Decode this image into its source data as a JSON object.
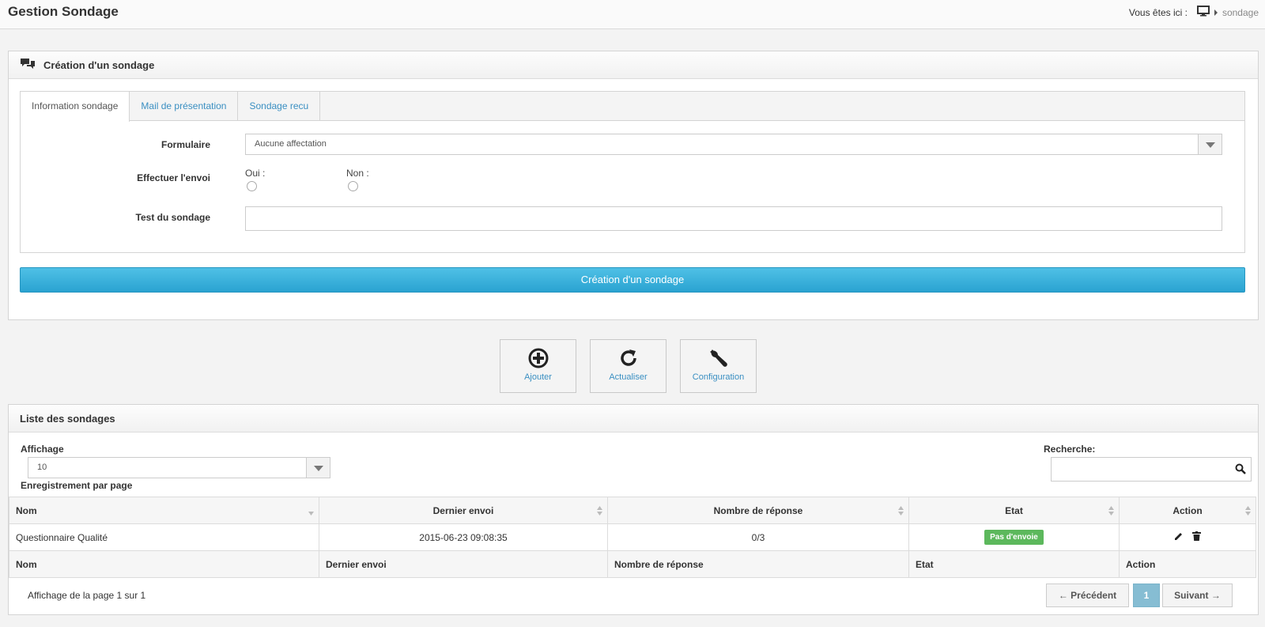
{
  "header": {
    "title": "Gestion Sondage",
    "breadcrumb_prefix": "Vous êtes ici :",
    "breadcrumb_current": "sondage"
  },
  "creation_panel": {
    "title": "Création d'un sondage",
    "tabs": [
      {
        "label": "Information sondage",
        "active": true
      },
      {
        "label": "Mail de présentation",
        "active": false
      },
      {
        "label": "Sondage recu",
        "active": false
      }
    ],
    "fields": {
      "formulaire_label": "Formulaire",
      "formulaire_value": "Aucune affectation",
      "envoi_label": "Effectuer l'envoi",
      "oui_label": "Oui :",
      "non_label": "Non :",
      "test_label": "Test du sondage",
      "test_value": ""
    },
    "submit_label": "Création d'un sondage"
  },
  "toolbar": {
    "add_label": "Ajouter",
    "refresh_label": "Actualiser",
    "config_label": "Configuration"
  },
  "list_panel": {
    "title": "Liste des sondages",
    "affichage_label": "Affichage",
    "page_size_value": "10",
    "per_page_label": "Enregistrement par page",
    "search_label": "Recherche:",
    "columns": [
      "Nom",
      "Dernier envoi",
      "Nombre de réponse",
      "Etat",
      "Action"
    ],
    "rows": [
      {
        "nom": "Questionnaire Qualité",
        "dernier_envoi": "2015-06-23 09:08:35",
        "nombre_reponse": "0/3",
        "etat": "Pas d'envoie"
      }
    ],
    "footer_columns": [
      "Nom",
      "Dernier envoi",
      "Nombre de réponse",
      "Etat",
      "Action"
    ],
    "page_info": "Affichage de la page 1 sur 1",
    "pager": {
      "prev_label": "← Précédent",
      "current_page": "1",
      "next_label": "Suivant →"
    }
  },
  "colors": {
    "primary": "#2aa3d1",
    "link": "#3a8fc2",
    "badge_success": "#5cb85c",
    "pager_active": "#86bdd3"
  }
}
